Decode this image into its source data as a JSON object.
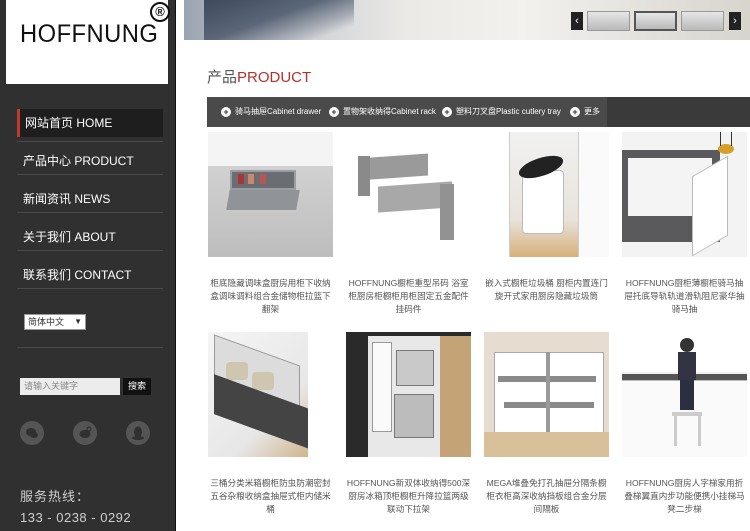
{
  "brand": {
    "name": "HOFFNUNG",
    "reg": "®"
  },
  "nav": [
    {
      "label": "网站首页 HOME",
      "active": true
    },
    {
      "label": "产品中心 PRODUCT"
    },
    {
      "label": "新闻资讯 NEWS"
    },
    {
      "label": "关于我们 ABOUT"
    },
    {
      "label": "联系我们 CONTACT"
    }
  ],
  "lang": {
    "selected": "简体中文"
  },
  "search": {
    "placeholder": "请输入关键字",
    "button": "搜索"
  },
  "social": [
    {
      "icon": "wechat-icon"
    },
    {
      "icon": "weibo-icon"
    },
    {
      "icon": "qq-icon"
    }
  ],
  "hotline": {
    "label": "服务热线：",
    "number": "133 - 0238 - 0292"
  },
  "section": {
    "prefix": "产品",
    "suffix": "PRODUCT"
  },
  "categories": [
    {
      "label": "骑马抽屉Cabinet drawer"
    },
    {
      "label": "置物架收纳得Cabinet rack"
    },
    {
      "label": "塑料刀叉盘Plastic cutlery tray"
    },
    {
      "label": "更多"
    }
  ],
  "products": [
    {
      "caption": "柜底隐藏调味盒厨房用柜下收纳盒调味调料组合金储物柜拉篮下翻架"
    },
    {
      "caption": "HOFFNUNG橱柜重型吊码 浴室柜厨房柜橱柜用柜固定五金配件挂码件"
    },
    {
      "caption": "嵌入式橱柜垃圾桶 厨柜内置连门旋开式家用厨房隐藏垃圾筒"
    },
    {
      "caption": "HOFFNUNG厨柜薄橱柜骑马抽屉托底导轨轨道滑轨阻尼豪华抽骑马抽"
    },
    {
      "caption": "三桶分类米箱橱柜防虫防潮密封五谷杂粮收纳盒抽屉式柜内储米桶"
    },
    {
      "caption": "HOFFNUNG新双体收纳得500深厨房冰箱顶柜橱柜升降拉篮两级联动下拉架"
    },
    {
      "caption": "MEGA堆叠免打孔抽屉分隔条橱柜衣柜高深收纳挡板组合金分层间隔板"
    },
    {
      "caption": "HOFFNUNG厨房人字梯家用折叠梯翼直内步功能便携小挂梯马凳二步梯"
    }
  ]
}
